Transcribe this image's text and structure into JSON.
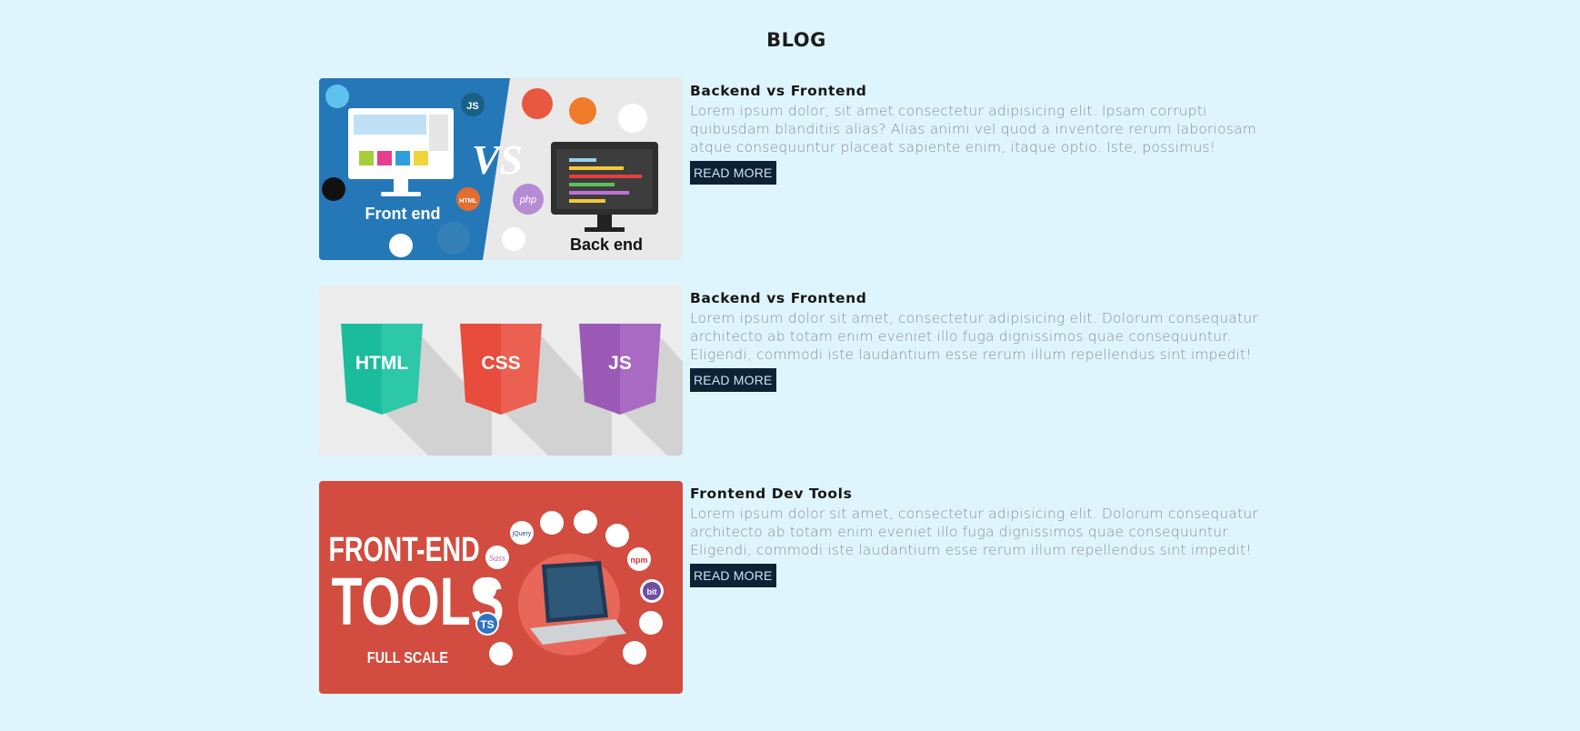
{
  "page": {
    "title": "BLOG"
  },
  "posts": [
    {
      "title": "Backend vs Frontend",
      "text": "Lorem ipsum dolor, sit amet consectetur adipisicing elit. Ipsam corrupti quibusdam blanditiis alias? Alias animi vel quod a inventore rerum laboriosam atque consequuntur placeat sapiente enim, itaque optio. Iste, possimus!",
      "button": "READ MORE",
      "image": {
        "left_label": "Front end",
        "right_label": "Back end",
        "vs_label": "VS",
        "badges": [
          "JS",
          "HTML",
          "php"
        ]
      }
    },
    {
      "title": "Backend vs Frontend",
      "text": "Lorem ipsum dolor sit amet, consectetur adipisicing elit. Dolorum consequatur architecto ab totam enim eveniet illo fuga dignissimos quae consequuntur. Eligendi, commodi iste laudantium esse rerum illum repellendus sint impedit!",
      "button": "READ MORE",
      "image": {
        "shields": [
          "HTML",
          "CSS",
          "JS"
        ]
      }
    },
    {
      "title": "Frontend Dev Tools",
      "text": "Lorem ipsum dolor sit amet, consectetur adipisicing elit. Dolorum consequatur architecto ab totam enim eveniet illo fuga dignissimos quae consequuntur. Eligendi, commodi iste laudantium esse rerum illum repellendus sint impedit!",
      "button": "READ MORE",
      "image": {
        "line1": "FRONT-END",
        "line2": "TOOLS",
        "line3": "FULL SCALE",
        "tool_badges": [
          "npm",
          "bit",
          "TS",
          "jQuery",
          "Sass"
        ]
      }
    }
  ],
  "colors": {
    "background": "#dff5fd",
    "button_bg": "#0d2234",
    "body_text": "#8a8f94"
  }
}
